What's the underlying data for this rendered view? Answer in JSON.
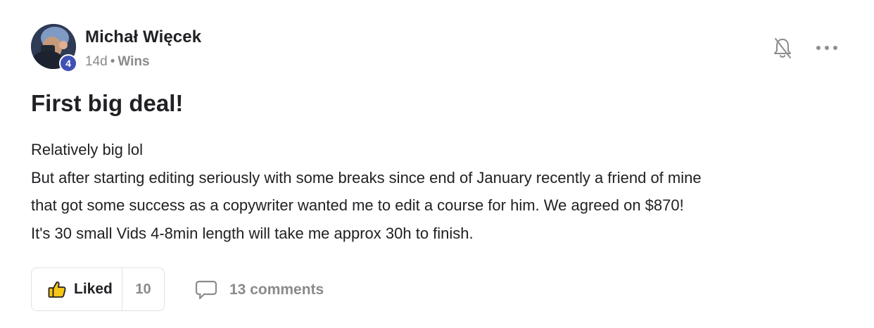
{
  "post": {
    "author": {
      "name": "Michał Więcek",
      "level": "4"
    },
    "meta": {
      "time_ago": "14d",
      "separator": "•",
      "category": "Wins"
    },
    "title": "First big deal!",
    "body_lines": [
      "Relatively big lol",
      "But after starting editing seriously with some breaks since end of January recently a friend of mine",
      "that got some success as a copywriter wanted me to edit a course for him. We agreed on $870!",
      "It's 30 small Vids 4-8min length will take me approx 30h to finish."
    ],
    "actions": {
      "like_label": "Liked",
      "like_count": "10",
      "comments_label": "13 comments"
    },
    "icons": {
      "like": "thumbs-up-icon",
      "comments": "speech-bubble-icon",
      "notifications": "bell-off-icon",
      "more": "more-horizontal-icon"
    },
    "colors": {
      "level_badge": "#3f51b5",
      "thumb_fill": "#f5c518",
      "muted_text": "#8a8a8a"
    }
  }
}
